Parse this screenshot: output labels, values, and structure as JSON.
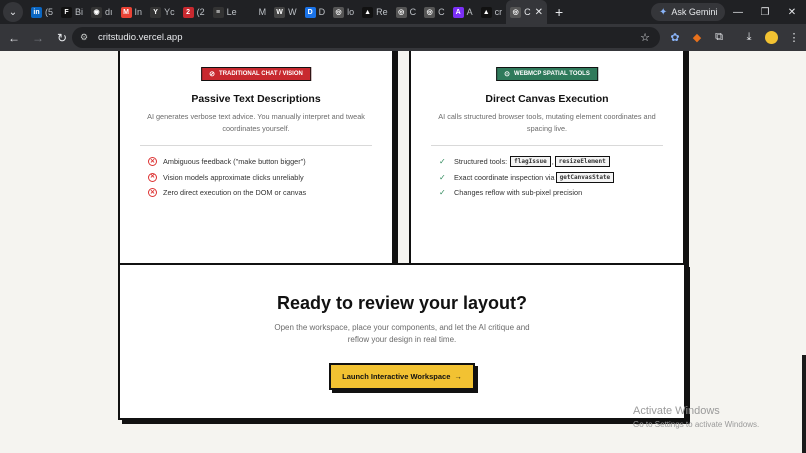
{
  "browser": {
    "tabs": [
      {
        "favicon": "linkedin-icon",
        "color": "#0a66c2",
        "glyph": "in",
        "label": "(5"
      },
      {
        "favicon": "f-icon",
        "color": "#111111",
        "glyph": "F",
        "label": "Bi"
      },
      {
        "favicon": "github-icon",
        "color": "#333333",
        "glyph": "◉",
        "label": "dı"
      },
      {
        "favicon": "gmail-icon",
        "color": "#ea4335",
        "glyph": "M",
        "label": "In"
      },
      {
        "favicon": "yc-icon",
        "color": "#333333",
        "glyph": "Y",
        "label": "Yc"
      },
      {
        "favicon": "notification-icon",
        "color": "#c8292f",
        "glyph": "2",
        "label": "(2"
      },
      {
        "favicon": "doc-icon",
        "color": "#333333",
        "glyph": "≡",
        "label": "Le"
      },
      {
        "favicon": "blank-icon",
        "color": "#202124",
        "glyph": "",
        "label": "M"
      },
      {
        "favicon": "w-icon",
        "color": "#444444",
        "glyph": "W",
        "label": "W"
      },
      {
        "favicon": "d-icon",
        "color": "#1a73e8",
        "glyph": "D",
        "label": "D"
      },
      {
        "favicon": "globe-icon",
        "color": "#555555",
        "glyph": "◎",
        "label": "lo"
      },
      {
        "favicon": "triangle-icon",
        "color": "#111111",
        "glyph": "▲",
        "label": "Re"
      },
      {
        "favicon": "globe-icon",
        "color": "#555555",
        "glyph": "◎",
        "label": "C"
      },
      {
        "favicon": "globe-icon",
        "color": "#555555",
        "glyph": "◎",
        "label": "C"
      },
      {
        "favicon": "a-icon",
        "color": "#7b2ff7",
        "glyph": "A",
        "label": "A"
      },
      {
        "favicon": "triangle-icon",
        "color": "#111111",
        "glyph": "▲",
        "label": "cr"
      }
    ],
    "active_tab": {
      "label": "C",
      "close": "✕"
    },
    "new_tab": "+",
    "ask_gemini": "Ask Gemini",
    "url": "critstudio.vercel.app"
  },
  "cards": [
    {
      "badge": "TRADITIONAL CHAT / VISION",
      "badge_icon": "⊘",
      "title": "Passive Text Descriptions",
      "desc": "AI generates verbose text advice. You manually interpret and tweak coordinates yourself.",
      "items": [
        "Ambiguous feedback (\"make button bigger\")",
        "Vision models approximate clicks unreliably",
        "Zero direct execution on the DOM or canvas"
      ]
    },
    {
      "badge": "WEBMCP SPATIAL TOOLS",
      "badge_icon": "⊙",
      "title": "Direct Canvas Execution",
      "desc": "AI calls structured browser tools, mutating element coordinates and spacing live.",
      "item1": {
        "text": "Structured tools:",
        "code1": "flagIssue",
        "sep": ",",
        "code2": "resizeElement"
      },
      "item2": {
        "text": "Exact coordinate inspection via",
        "code": "getCanvasState"
      },
      "item3": "Changes reflow with sub-pixel precision"
    }
  ],
  "cta": {
    "title": "Ready to review your layout?",
    "subtitle": "Open the workspace, place your components, and let the AI critique and reflow your design in real time.",
    "button": "Launch Interactive Workspace",
    "arrow": "→"
  },
  "watermark": {
    "title": "Activate Windows",
    "subtitle": "Go to Settings to activate Windows."
  },
  "colors": {
    "accent_yellow": "#f2c232",
    "badge_red": "#c8292f",
    "badge_green": "#2f7a5b"
  }
}
